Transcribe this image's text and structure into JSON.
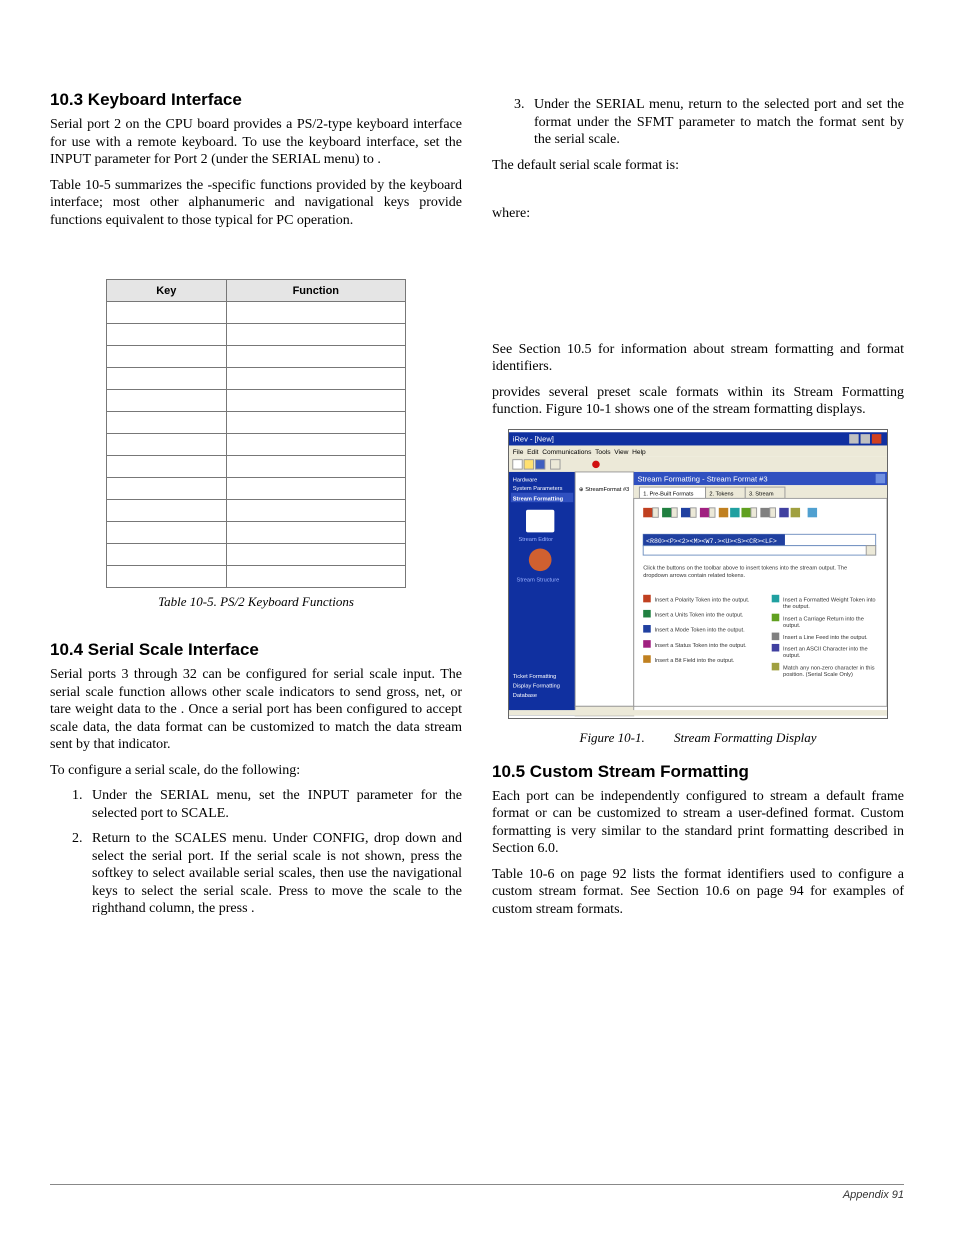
{
  "left": {
    "heading": "10.3 Keyboard Interface",
    "p1_a": "Serial port 2 on the ",
    "p1_b": " CPU board provides a PS/2-type keyboard interface for use with a remote keyboard. To use the keyboard interface, set the INPUT parameter for Port 2 (under the SERIAL menu) to ",
    "p1_c": ".",
    "p2_a": "Table 10-5 summarizes the ",
    "p2_b": "-specific functions provided by the keyboard interface; most other alphanumeric and navigational keys provide functions equivalent to those typical for PC operation.",
    "table": {
      "headers": [
        "Key",
        "Function"
      ],
      "rows": [
        [
          "",
          ""
        ],
        [
          "",
          ""
        ],
        [
          "",
          ""
        ],
        [
          "",
          ""
        ],
        [
          "",
          ""
        ],
        [
          "",
          ""
        ],
        [
          "",
          ""
        ],
        [
          "",
          ""
        ],
        [
          "",
          ""
        ],
        [
          "",
          ""
        ],
        [
          "",
          ""
        ],
        [
          "",
          ""
        ],
        [
          "",
          ""
        ]
      ]
    },
    "table_caption": "Table 10-5. PS/2 Keyboard Functions",
    "heading2": "10.4 Serial Scale Interface",
    "p3_a": "Serial ports 3 through 32 can be configured for serial scale input. The serial scale function allows other scale indicators to send gross, net, or tare weight data to the ",
    "p3_b": ". Once a serial port has been configured to accept scale data, the data format can be customized to match the data stream sent by that indicator.",
    "p4": "To configure a serial scale, do the following:",
    "steps": [
      "Under the SERIAL menu, set the INPUT parameter for the selected port to SCALE.",
      "Return to the SCALES menu. Under CONFIG, drop down and select the serial port. If the serial scale is not shown, press the               softkey to select available serial scales, then use the navigational keys to select the serial scale. Press          to move the scale to the righthand column, the press          ."
    ]
  },
  "right": {
    "step3": "Under the SERIAL menu, return to the selected port and set the format under the SFMT parameter to match the format sent by the serial scale.",
    "p1": "The default serial scale format is:",
    "p2": "where:",
    "p3": "See Section 10.5 for information about stream formatting and format identifiers.",
    "p4_a": "",
    "p4_b": " provides several preset scale formats within its Stream Formatting function. Figure 10-1 shows one of the ",
    "p4_c": " stream formatting displays.",
    "fig_caption_a": "Figure 10-1. ",
    "fig_caption_b": " Stream Formatting Display",
    "heading": "10.5 Custom Stream Formatting",
    "p5": "Each port can be independently configured to stream a default frame format or can be customized to stream a user-defined format. Custom formatting is very similar to the standard print formatting described in Section 6.0.",
    "p6": "Table 10-6 on page 92 lists the format identifiers used to configure a custom stream format. See Section 10.6 on page 94 for examples of custom stream formats."
  },
  "figure": {
    "title_bar": "iRev - [New]",
    "menu": [
      "File",
      "Edit",
      "Communications",
      "Tools",
      "View",
      "Help"
    ],
    "nav_items": [
      "Hardware",
      "System Parameters",
      "Stream Formatting"
    ],
    "nav_sub1": "Stream Editor",
    "nav_sub2": "Stream Structure",
    "bottom_nav": [
      "Ticket Formatting",
      "Display Formatting",
      "Database"
    ],
    "tree_item": "StreamFormat #3",
    "header_bar": "Stream Formatting - Stream Format #3",
    "tabs": [
      "1. Pre-Built Formats",
      "2. Tokens",
      "3. Stream"
    ],
    "format_string": "<R80><P><2><M><W7.><U><S><CR><LF>",
    "hint": "Click the buttons on the toolbar above to insert tokens into the stream output. The dropdown arrows contain related tokens.",
    "token_list_left": [
      "Insert a Polarity Token into the output.",
      "Insert a Units Token into the output.",
      "Insert a Mode Token into the output.",
      "Insert a Status Token into the output.",
      "Insert a Bit Field into the output."
    ],
    "token_list_right": [
      "Insert a Formatted Weight Token into the output.",
      "Insert a Carriage Return into the output.",
      "Insert a Line Feed into the output.",
      "Insert an ASCII Character into the output.",
      "Match any non-zero character in this position. (Serial Scale Only)"
    ]
  },
  "footer": {
    "left": "",
    "right": "Appendix     91"
  }
}
